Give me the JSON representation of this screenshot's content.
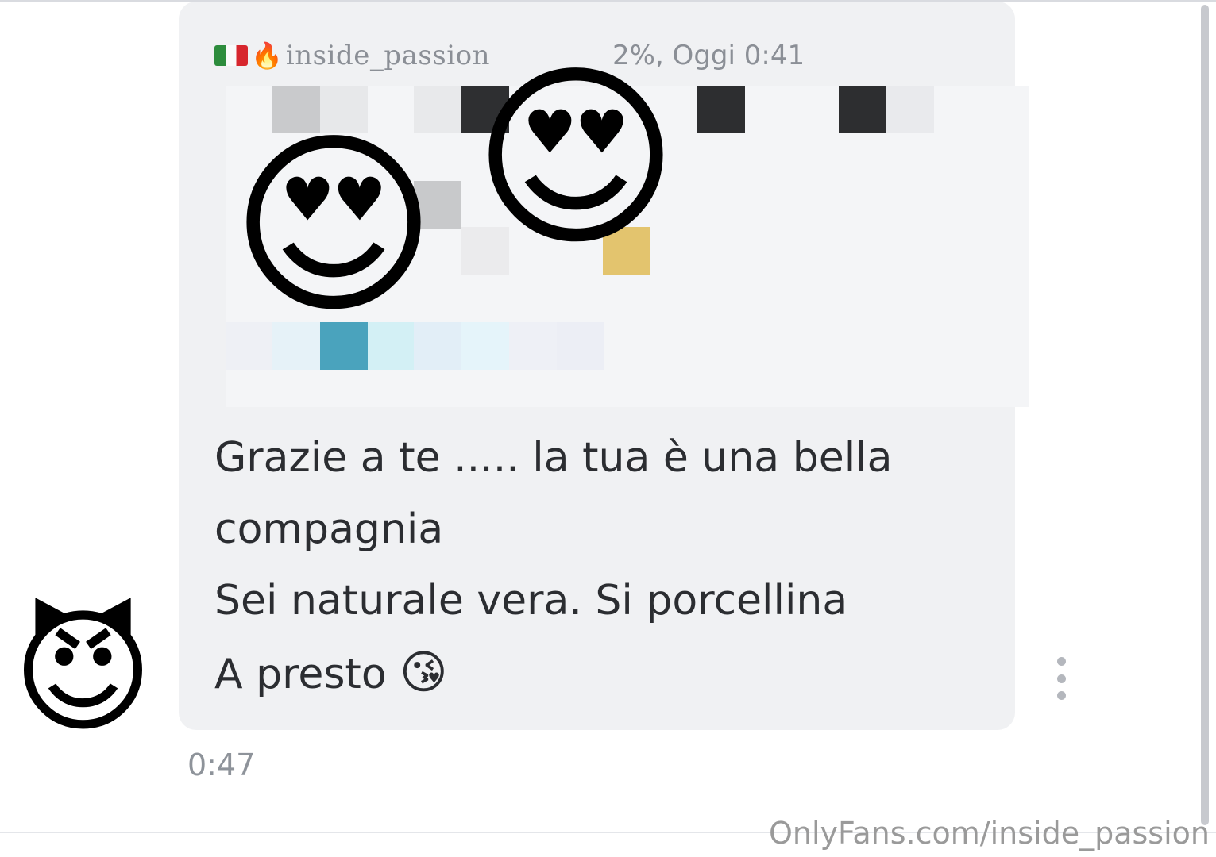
{
  "quoted": {
    "flag_icon": "italy-flag-icon",
    "fire_icon": "🔥",
    "handle": "inside_passion",
    "rating_text": "2%, Oggi 0:41"
  },
  "stickers": {
    "heart_eyes": "😍"
  },
  "message": {
    "line1": "Grazie a te ..... la tua è una bella",
    "line2": "compagnia",
    "line3": "Sei naturale vera. Si porcellina",
    "line4": "A presto",
    "kiss_emoji": "😘",
    "time": "0:47"
  },
  "avatar": {
    "emoji": "😈"
  },
  "watermark": "OnlyFans.com/inside_passion",
  "colors": {
    "bubble": "#f0f1f3",
    "text": "#2b2d31",
    "muted": "#8b8f96"
  }
}
